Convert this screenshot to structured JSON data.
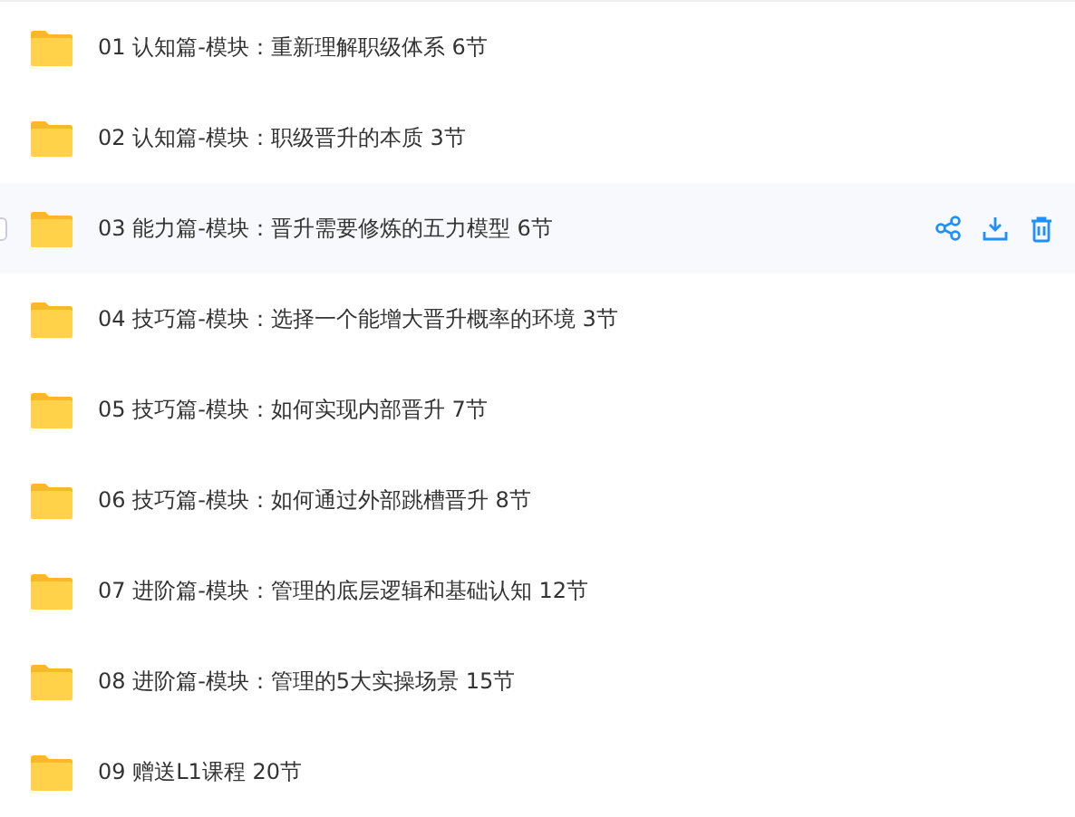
{
  "folders": [
    {
      "name": "01 认知篇-模块：重新理解职级体系 6节",
      "hovered": false
    },
    {
      "name": "02 认知篇-模块：职级晋升的本质 3节",
      "hovered": false
    },
    {
      "name": "03 能力篇-模块：晋升需要修炼的五力模型 6节",
      "hovered": true
    },
    {
      "name": "04 技巧篇-模块：选择一个能增大晋升概率的环境 3节",
      "hovered": false
    },
    {
      "name": "05 技巧篇-模块：如何实现内部晋升 7节",
      "hovered": false
    },
    {
      "name": "06 技巧篇-模块：如何通过外部跳槽晋升 8节",
      "hovered": false
    },
    {
      "name": "07 进阶篇-模块：管理的底层逻辑和基础认知 12节",
      "hovered": false
    },
    {
      "name": "08 进阶篇-模块：管理的5大实操场景 15节",
      "hovered": false
    },
    {
      "name": "09 赠送L1课程 20节",
      "hovered": false
    }
  ]
}
